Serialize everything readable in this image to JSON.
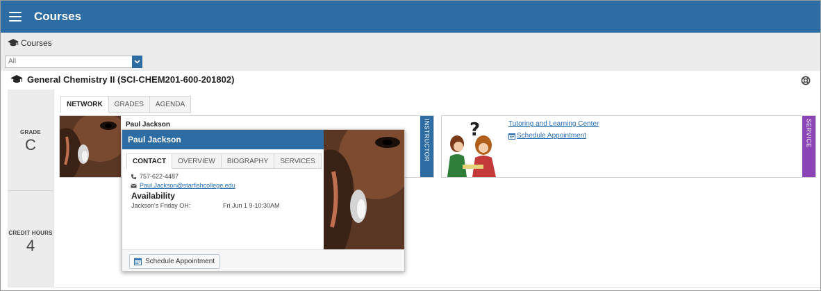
{
  "app": {
    "title": "Courses"
  },
  "breadcrumb": {
    "label": "Courses"
  },
  "filter": {
    "selected": "All"
  },
  "course": {
    "title": "General Chemistry II (SCI-CHEM201-600-201802)"
  },
  "stats": {
    "grade_label": "GRADE",
    "grade_value": "C",
    "credit_label": "CREDIT HOURS",
    "credit_value": "4"
  },
  "tabs": [
    {
      "label": "NETWORK",
      "active": true
    },
    {
      "label": "GRADES",
      "active": false
    },
    {
      "label": "AGENDA",
      "active": false
    }
  ],
  "instructor_card": {
    "name": "Paul Jackson",
    "role": "INSTRUCTOR"
  },
  "service_card": {
    "name": "Tutoring and Learning Center",
    "appointment": "Schedule Appointment",
    "role": "SERVICE"
  },
  "popup": {
    "name": "Paul Jackson",
    "tabs": [
      {
        "label": "CONTACT",
        "active": true
      },
      {
        "label": "OVERVIEW",
        "active": false
      },
      {
        "label": "BIOGRAPHY",
        "active": false
      },
      {
        "label": "SERVICES",
        "active": false
      }
    ],
    "phone": "757-622-4487",
    "email": "Paul.Jackson@starfishcollege.edu",
    "availability_title": "Availability",
    "availability_label": "Jackson's Friday OH:",
    "availability_time": "Fri Jun 1 9-10:30AM",
    "schedule_button": "Schedule Appointment"
  },
  "colors": {
    "primary": "#2d6da3",
    "service": "#8b44b5",
    "link": "#2a6cb0"
  },
  "icons": {
    "menu": "hamburger-icon",
    "course": "graduation-cap-icon",
    "help": "lifebuoy-icon",
    "phone": "phone-icon",
    "email": "envelope-icon",
    "calendar": "calendar-icon"
  }
}
